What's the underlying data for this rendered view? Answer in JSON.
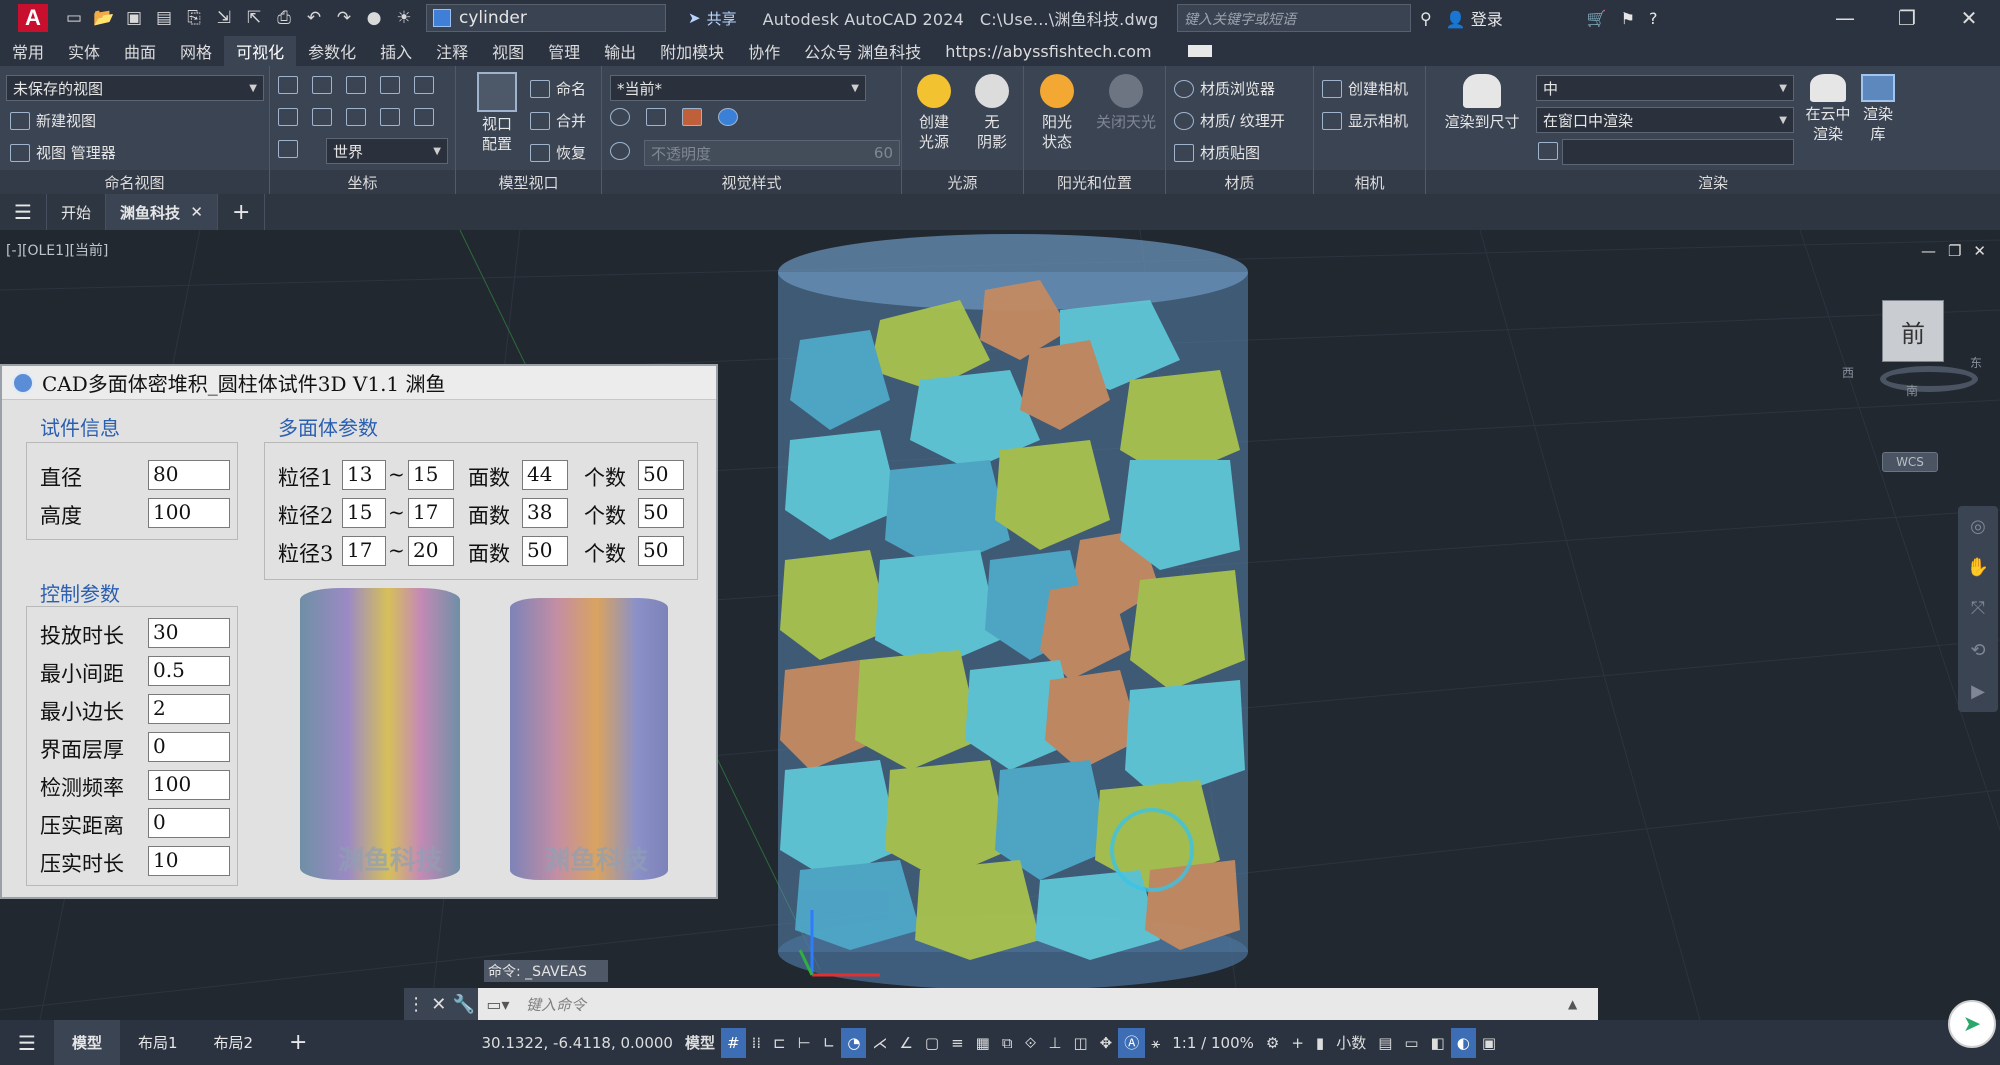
{
  "titlebar": {
    "logo": "A",
    "workspace": "cylinder",
    "share": "共享",
    "app_title": "Autodesk AutoCAD 2024",
    "file_path": "C:\\Use...\\渊鱼科技.dwg",
    "search_placeholder": "键入关键字或短语",
    "login": "登录"
  },
  "ribbon_tabs": [
    "常用",
    "实体",
    "曲面",
    "网格",
    "可视化",
    "参数化",
    "插入",
    "注释",
    "视图",
    "管理",
    "输出",
    "附加模块",
    "协作",
    "公众号 渊鱼科技",
    "https://abyssfishtech.com"
  ],
  "ribbon": {
    "named_views": {
      "combo": "未保存的视图",
      "new_view": "新建视图",
      "view_manager": "视图 管理器",
      "title": "命名视图"
    },
    "coords": {
      "combo": "世界",
      "title": "坐标"
    },
    "model_viewport": {
      "config": "视口\n配置",
      "name": "命名",
      "merge": "合并",
      "restore": "恢复",
      "title": "模型视口"
    },
    "visual_style": {
      "combo": "*当前*",
      "opacity": "不透明度",
      "opacity_value": "60",
      "title": "视觉样式"
    },
    "lights": {
      "create": "创建\n光源",
      "no_shadow": "无\n阴影",
      "title": "光源"
    },
    "sun": {
      "sun_status": "阳光\n状态",
      "sky_off": "关闭天光",
      "title": "阳光和位置"
    },
    "materials": {
      "browser": "材质浏览器",
      "texture": "材质/ 纹理开",
      "mapping": "材质贴图",
      "title": "材质"
    },
    "camera": {
      "create": "创建相机",
      "show": "显示相机",
      "title": "相机"
    },
    "render": {
      "render_size": "渲染到尺寸",
      "quality": "中",
      "render_in": "在窗口中渲染",
      "cloud": "在云中\n渲染",
      "library": "渲染\n库",
      "title": "渲染"
    }
  },
  "doc_tabs": {
    "start": "开始",
    "active": "渊鱼科技"
  },
  "viewport": {
    "label": "[-][OLE1][当前]",
    "viewcube_face": "前",
    "viewcube_south": "南",
    "viewcube_west": "西",
    "viewcube_east": "东",
    "wcs": "WCS"
  },
  "dialog": {
    "title": "CAD多面体密堆积_圆柱体试件3D V1.1 渊鱼",
    "specimen_title": "试件信息",
    "diameter_label": "直径",
    "diameter": "80",
    "height_label": "高度",
    "height": "100",
    "poly_title": "多面体参数",
    "poly_rows": [
      {
        "label": "粒径1",
        "min": "13",
        "max": "15",
        "faces_label": "面数",
        "faces": "44",
        "count_label": "个数",
        "count": "50"
      },
      {
        "label": "粒径2",
        "min": "15",
        "max": "17",
        "faces_label": "面数",
        "faces": "38",
        "count_label": "个数",
        "count": "50"
      },
      {
        "label": "粒径3",
        "min": "17",
        "max": "20",
        "faces_label": "面数",
        "faces": "50",
        "count_label": "个数",
        "count": "50"
      }
    ],
    "tilde": "~",
    "control_title": "控制参数",
    "controls": [
      {
        "label": "投放时长",
        "value": "30"
      },
      {
        "label": "最小间距",
        "value": "0.5"
      },
      {
        "label": "最小边长",
        "value": "2"
      },
      {
        "label": "界面层厚",
        "value": "0"
      },
      {
        "label": "检测频率",
        "value": "100"
      },
      {
        "label": "压实距离",
        "value": "0"
      },
      {
        "label": "压实时长",
        "value": "10"
      }
    ],
    "watermark": "渊鱼科技"
  },
  "command": {
    "history": "命令: _SAVEAS",
    "placeholder": "键入命令"
  },
  "status": {
    "model_tab": "模型",
    "layout1": "布局1",
    "layout2": "布局2",
    "coords": "30.1322, -6.4118, 0.0000",
    "space": "模型",
    "scale": "1:1 / 100%",
    "units": "小数"
  },
  "colors": {
    "accent": "#3d6eb5",
    "tan": "#c48a62",
    "teal": "#5fc6d6",
    "green": "#9dbb4a"
  }
}
